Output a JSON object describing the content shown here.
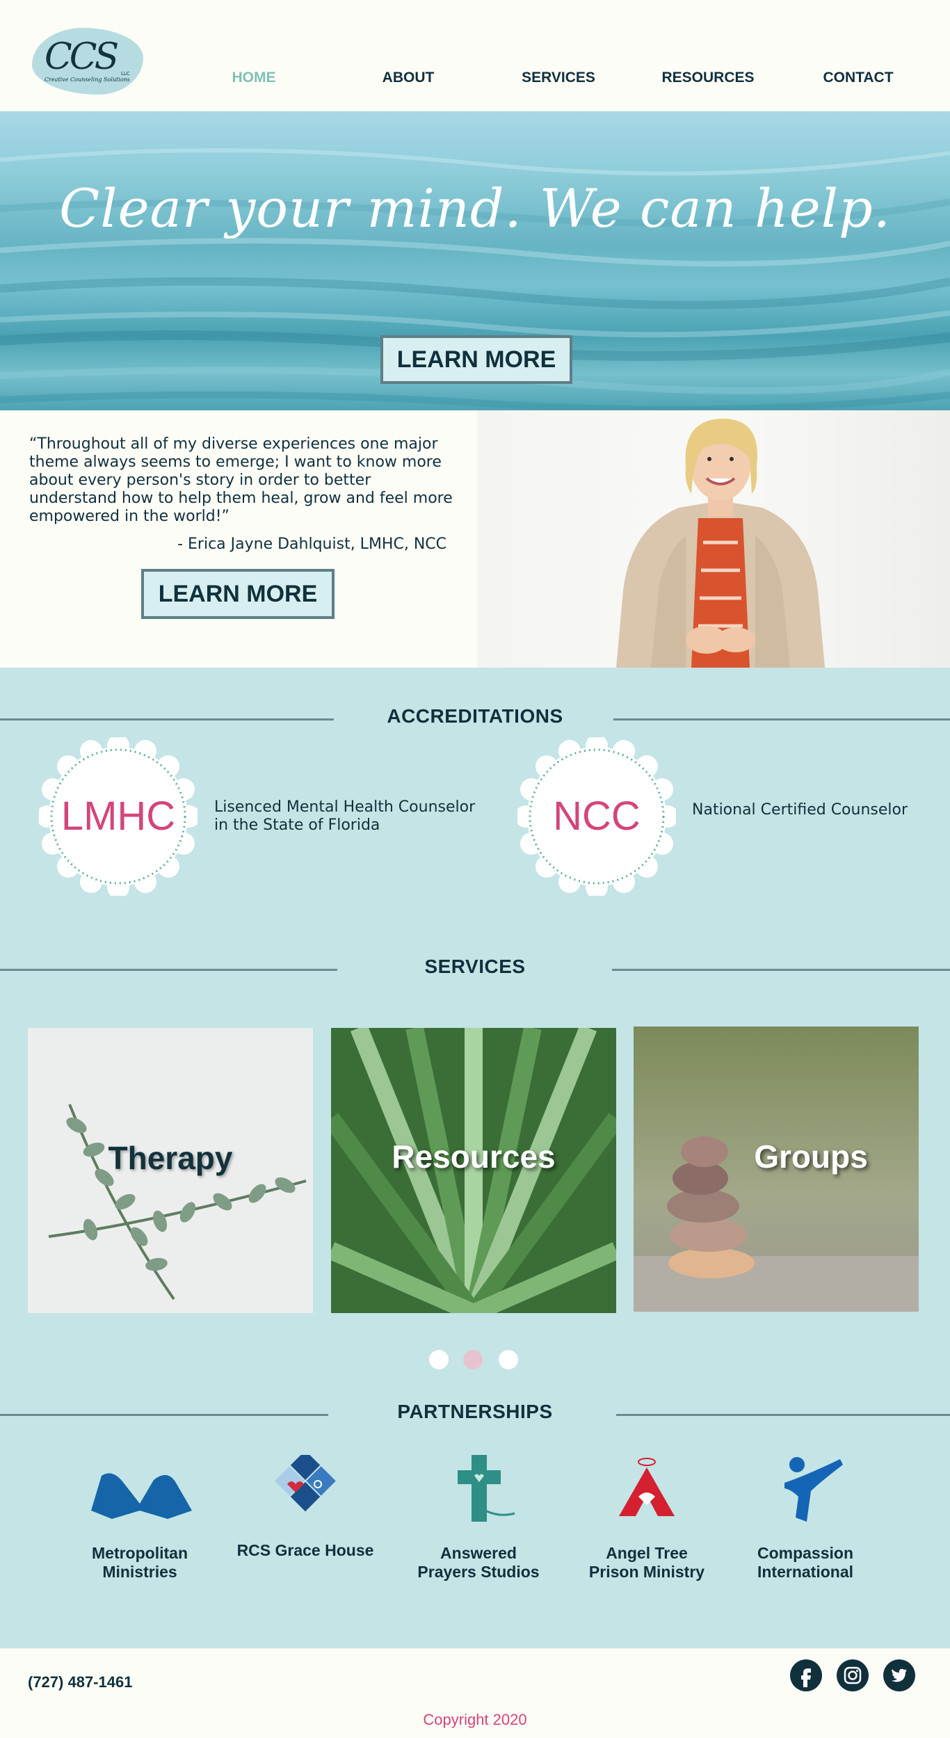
{
  "brand": {
    "logo_mark": "CCS",
    "logo_suffix": "LLC",
    "logo_subtitle": "Creative Counseling Solutions"
  },
  "nav": {
    "items": [
      {
        "label": "HOME",
        "active": true
      },
      {
        "label": "ABOUT",
        "active": false
      },
      {
        "label": "SERVICES",
        "active": false
      },
      {
        "label": "RESOURCES",
        "active": false
      },
      {
        "label": "CONTACT",
        "active": false
      }
    ]
  },
  "hero": {
    "tagline": "Clear your mind. We can help.",
    "button_label": "LEARN MORE"
  },
  "quote": {
    "text": "“Throughout all of my diverse experiences one major theme always seems to emerge; I want to know more about every person's story in order to better understand how to help them heal, grow and feel more empowered in the world!”",
    "author": "- Erica Jayne Dahlquist, LMHC, NCC",
    "button_label": "LEARN MORE"
  },
  "accreditations": {
    "heading": "ACCREDITATIONS",
    "items": [
      {
        "badge": "LMHC",
        "description_line1": "Lisenced Mental Health Counselor",
        "description_line2": "in the State of Florida"
      },
      {
        "badge": "NCC",
        "description_line1": "National Certified Counselor",
        "description_line2": ""
      }
    ]
  },
  "services": {
    "heading": "SERVICES",
    "tiles": [
      {
        "label": "Therapy"
      },
      {
        "label": "Resources"
      },
      {
        "label": "Groups"
      }
    ],
    "carousel": {
      "count": 3,
      "active_index": 1
    }
  },
  "partnerships": {
    "heading": "PARTNERSHIPS",
    "items": [
      {
        "line1": "Metropolitan",
        "line2": "Ministries"
      },
      {
        "line1": "RCS Grace House",
        "line2": ""
      },
      {
        "line1": "Answered",
        "line2": "Prayers Studios"
      },
      {
        "line1": "Angel Tree",
        "line2": "Prison Ministry"
      },
      {
        "line1": "Compassion",
        "line2": "International"
      }
    ]
  },
  "footer": {
    "phone": "(727) 487-1461",
    "social": [
      "facebook-icon",
      "instagram-icon",
      "twitter-icon"
    ],
    "copyright": "Copyright 2020"
  },
  "colors": {
    "accent_teal": "#7fc0b7",
    "navy": "#10303c",
    "pink": "#d3457a",
    "panel": "#c4e4e6",
    "cream": "#fdfdf7"
  }
}
